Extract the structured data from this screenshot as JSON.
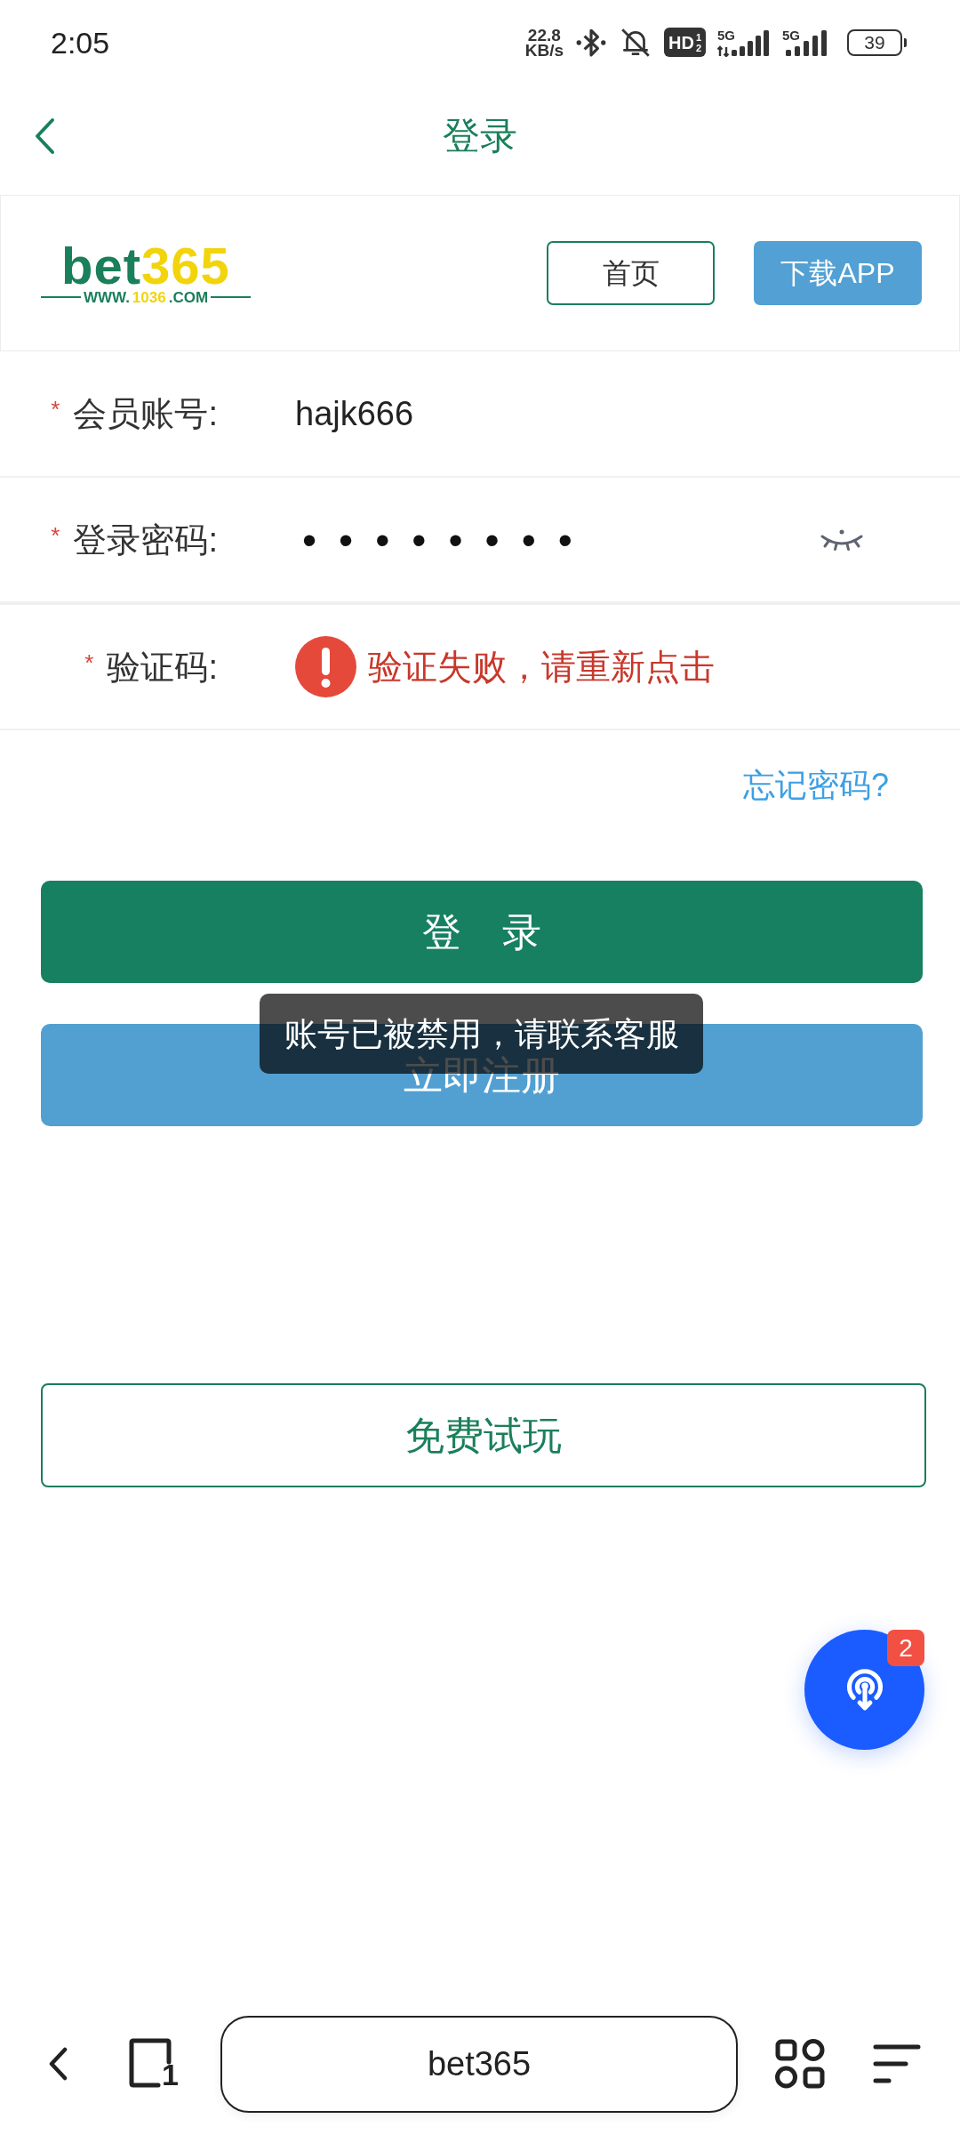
{
  "status_bar": {
    "time": "2:05",
    "net_speed": {
      "value": "22.8",
      "unit": "KB/s"
    },
    "hd_badge": {
      "text": "HD",
      "sup": "1",
      "sub": "2"
    },
    "signals": [
      {
        "label": "5G",
        "activity": true
      },
      {
        "label": "5G",
        "activity": false
      }
    ],
    "battery": "39"
  },
  "header": {
    "title": "登录"
  },
  "brand_bar": {
    "logo": {
      "name_parts": [
        {
          "text": "bet",
          "color": "#1a7f5b"
        },
        {
          "text": "365",
          "color": "#f2d40c"
        }
      ],
      "url_parts": [
        {
          "text": "WWW.",
          "color": "#1a7f5b"
        },
        {
          "text": "1036",
          "color": "#f2d40c"
        },
        {
          "text": ".COM",
          "color": "#1a7f5b"
        }
      ]
    },
    "buttons": [
      {
        "label": "首页",
        "kind": "outline"
      },
      {
        "label": "下载APP",
        "kind": "filled"
      }
    ]
  },
  "form": {
    "fields": [
      {
        "kind": "text",
        "required_mark": "*",
        "label": "会员账号:",
        "value": "hajk666"
      },
      {
        "kind": "password",
        "required_mark": "*",
        "label": "登录密码:",
        "value": "••••••••"
      },
      {
        "kind": "captcha",
        "required_mark": "*",
        "label": "验证码:",
        "error": "验证失败，请重新点击"
      }
    ],
    "forgot_link": "忘记密码?"
  },
  "actions": [
    {
      "label": "登 录",
      "kind": "primary"
    },
    {
      "label": "立即注册",
      "kind": "secondary"
    }
  ],
  "trial_button": {
    "label": "免费试玩"
  },
  "toast": {
    "message": "账号已被禁用，请联系客服"
  },
  "float_button": {
    "badge": "2"
  },
  "browser_bar": {
    "tab_count": "1",
    "address": "bet365"
  }
}
